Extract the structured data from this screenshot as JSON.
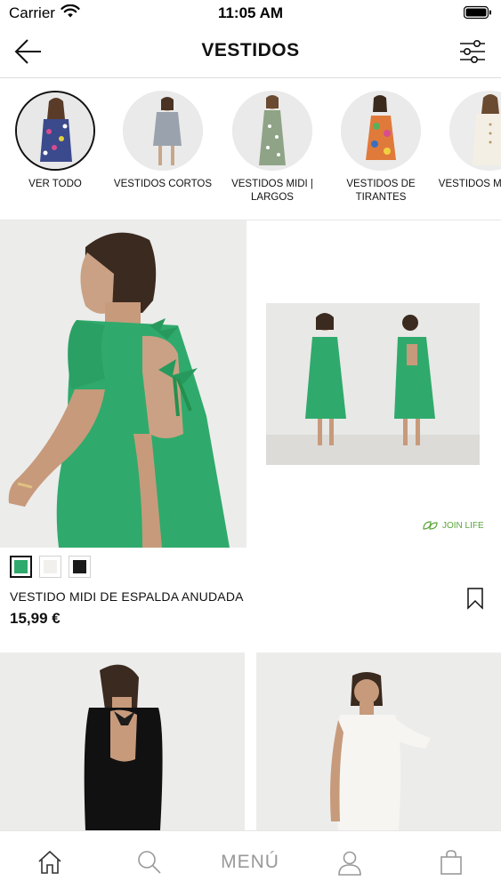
{
  "status_bar": {
    "carrier": "Carrier",
    "time": "11:05 AM"
  },
  "header": {
    "title": "VESTIDOS",
    "back_icon": "arrow-left-icon",
    "filter_icon": "sliders-icon"
  },
  "categories": [
    {
      "label": "VER TODO",
      "active": true
    },
    {
      "label": "VESTIDOS CORTOS",
      "active": false
    },
    {
      "label": "VESTIDOS MIDI | LARGOS",
      "active": false
    },
    {
      "label": "VESTIDOS DE TIRANTES",
      "active": false
    },
    {
      "label": "VESTIDOS MANGA C",
      "active": false
    }
  ],
  "featured_product": {
    "name": "VESTIDO MIDI DE ESPALDA ANUDADA",
    "price": "15,99 €",
    "badge": "JOIN LIFE",
    "swatches": [
      {
        "color": "#2faa6c",
        "selected": true
      },
      {
        "color": "#f2f0ec",
        "selected": false
      },
      {
        "color": "#1a1a1a",
        "selected": false
      }
    ]
  },
  "colors": {
    "join_life_green": "#5aa63c",
    "dress_green": "#2faa6c"
  },
  "tab_bar": {
    "menu_label": "MENÚ",
    "icons": [
      "home-icon",
      "search-icon",
      "user-icon",
      "bag-icon"
    ]
  }
}
